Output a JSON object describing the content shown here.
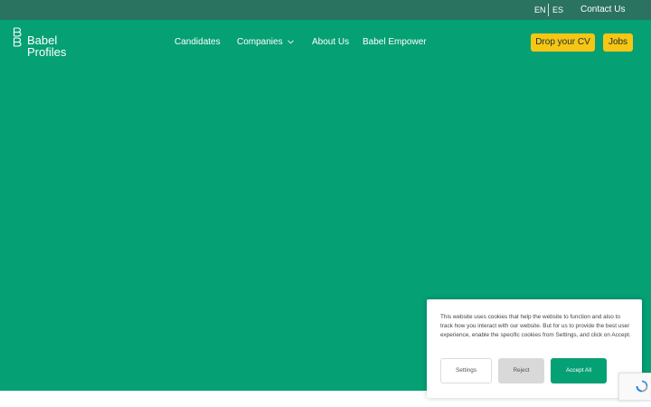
{
  "topbar": {
    "languages": [
      {
        "code": "EN"
      },
      {
        "code": "ES"
      }
    ],
    "contact_label": "Contact Us"
  },
  "header": {
    "logo": {
      "line1": "Babel",
      "line2": "Profiles",
      "icon": "double-b-logo-icon"
    },
    "nav": [
      {
        "label": "Candidates"
      },
      {
        "label": "Companies",
        "icon": "chevron-down-icon"
      },
      {
        "label": "About Us"
      },
      {
        "label": "Babel Empower"
      }
    ],
    "cta": {
      "drop_cv_label": "Drop your CV",
      "jobs_label": "Jobs"
    }
  },
  "cookie_banner": {
    "text": "This website uses cookies that help the website to function and also to track how you interact with our website. But for us to provide the best user experience, enable the specific cookies from Settings, and click on Accept.",
    "settings_label": "Settings",
    "reject_label": "Reject",
    "accept_label": "Accept All"
  },
  "recaptcha": {
    "icon": "recaptcha-icon"
  },
  "colors": {
    "topbar": "#2a7360",
    "brand_green": "#05a074",
    "accent_yellow": "#f6c615",
    "reject_gray": "#d9d9d9"
  }
}
